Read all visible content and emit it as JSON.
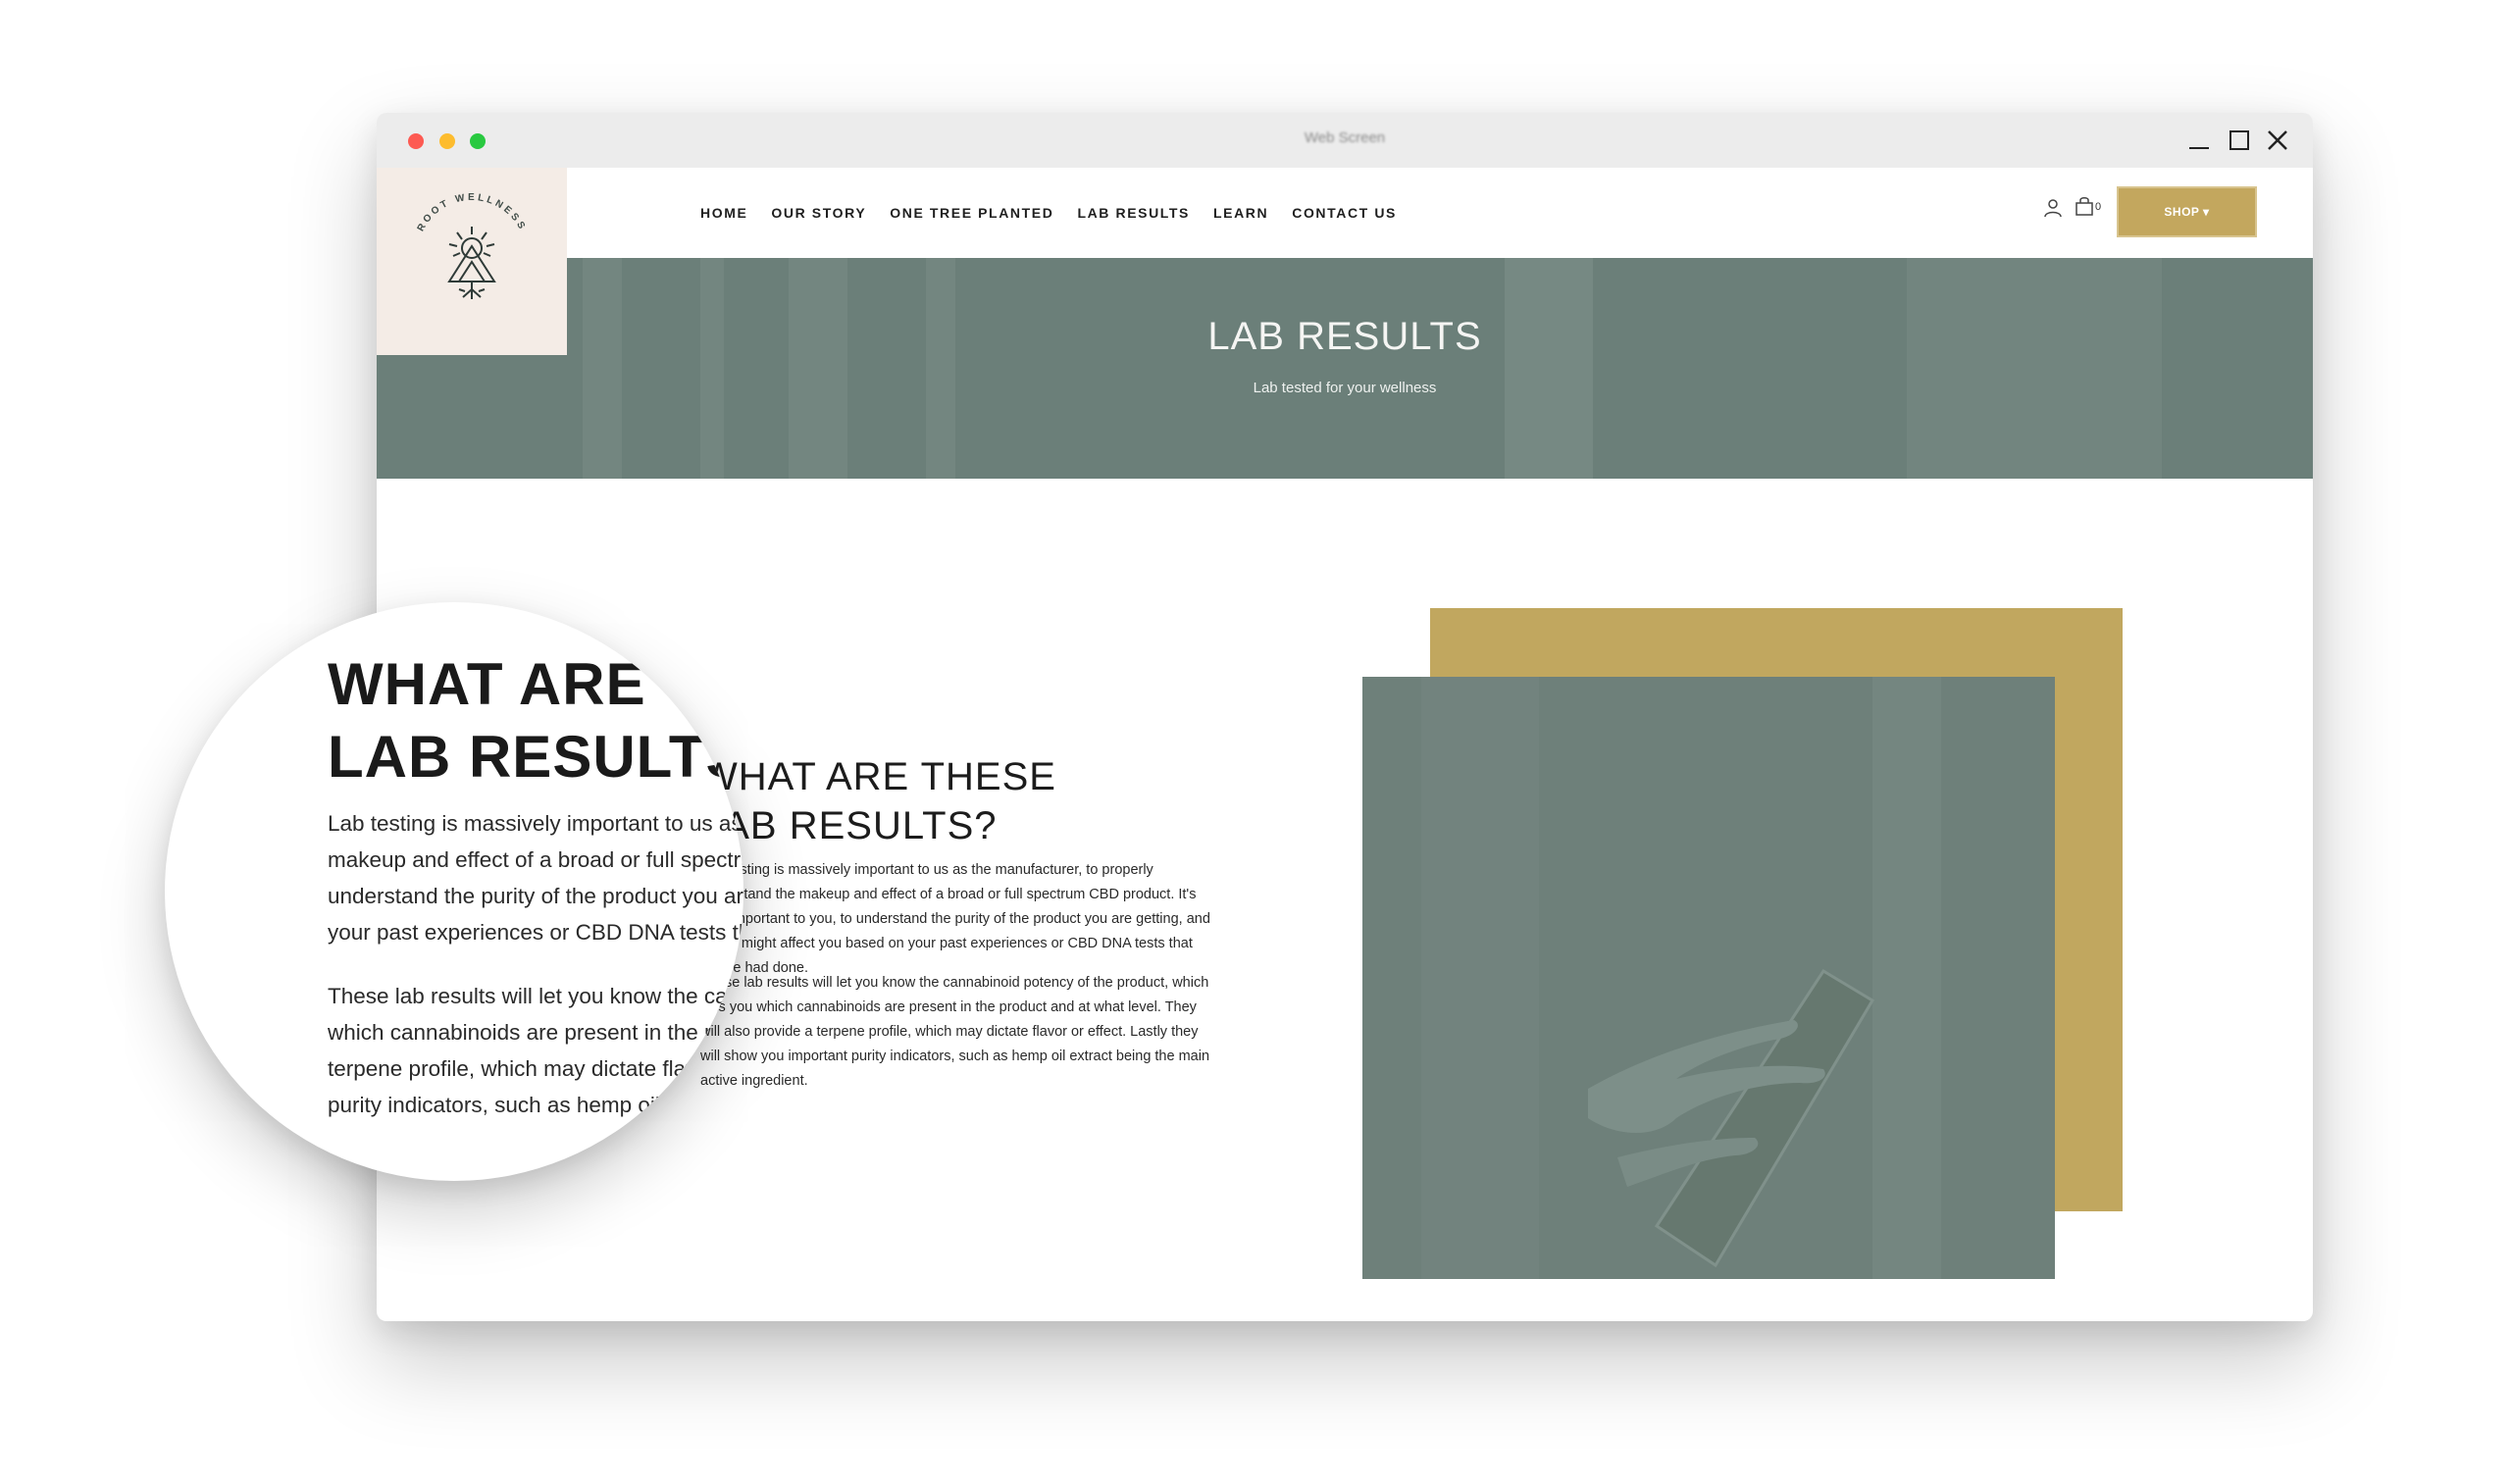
{
  "window": {
    "title": "Web Screen"
  },
  "site": {
    "logo_text": "ROOT WELLNESS",
    "nav": [
      "HOME",
      "OUR STORY",
      "ONE TREE PLANTED",
      "LAB RESULTS",
      "LEARN",
      "CONTACT US"
    ],
    "cart_count": "0",
    "shop_label": "SHOP ▾"
  },
  "hero": {
    "title": "LAB RESULTS",
    "subtitle": "Lab tested for your wellness"
  },
  "content": {
    "heading": "WHAT ARE THESE\nLAB RESULTS?",
    "paragraph1": "Lab testing is massively important to us as the manufacturer, to properly understand the makeup and effect of a broad or full spectrum CBD product. It's also important to you, to understand the purity of the product you are getting, and how it might affect you based on your past experiences or CBD DNA tests that you've had done.",
    "paragraph2": "These lab results will let you know the cannabinoid potency of the product, which tells you which cannabinoids are present in the product and at what level. They will also provide a terpene profile, which may dictate flavor or effect. Lastly they will show you important purity indicators, such as hemp oil extract being the main active ingredient."
  },
  "colors": {
    "accent_gold": "#c3a75e",
    "hero_teal": "#6b7f79",
    "logo_bg": "#f4ece6"
  },
  "icons": [
    "user-icon",
    "cart-icon",
    "close-icon",
    "minimize-icon",
    "maximize-icon"
  ]
}
